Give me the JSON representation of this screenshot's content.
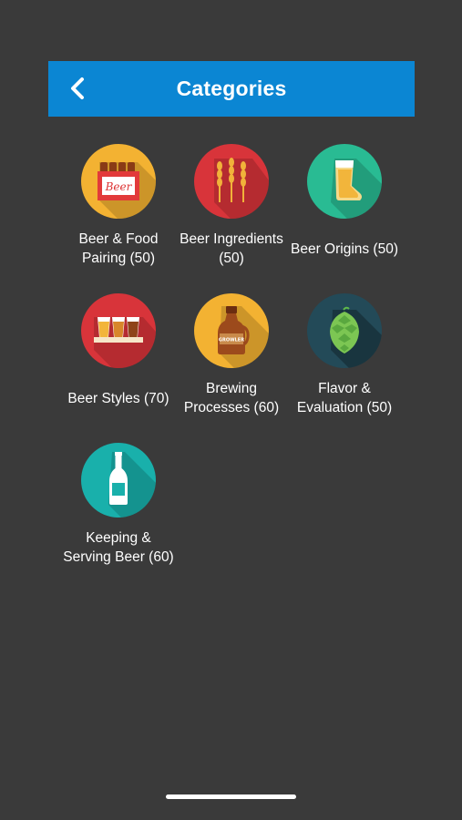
{
  "header": {
    "title": "Categories",
    "back_icon": "chevron-left-icon"
  },
  "categories": [
    {
      "label": "Beer & Food\nPairing (50)",
      "icon": "beer-crate-icon",
      "color": "#f3b232",
      "crate_text": "Beer"
    },
    {
      "label": "Beer Ingredients\n(50)",
      "icon": "wheat-icon",
      "color": "#d8343a"
    },
    {
      "label": "Beer Origins (50)",
      "icon": "beer-boot-icon",
      "color": "#29bb93"
    },
    {
      "label": "Beer Styles (70)",
      "icon": "beer-flight-icon",
      "color": "#d8343a"
    },
    {
      "label": "Brewing\nProcesses (60)",
      "icon": "growler-icon",
      "color": "#f3b232",
      "growler_text": "GROWLER"
    },
    {
      "label": "Flavor &\nEvaluation (50)",
      "icon": "hop-icon",
      "color": "#234a58"
    },
    {
      "label": "Keeping &\nServing Beer (60)",
      "icon": "beer-bottle-icon",
      "color": "#19b0ab"
    }
  ]
}
